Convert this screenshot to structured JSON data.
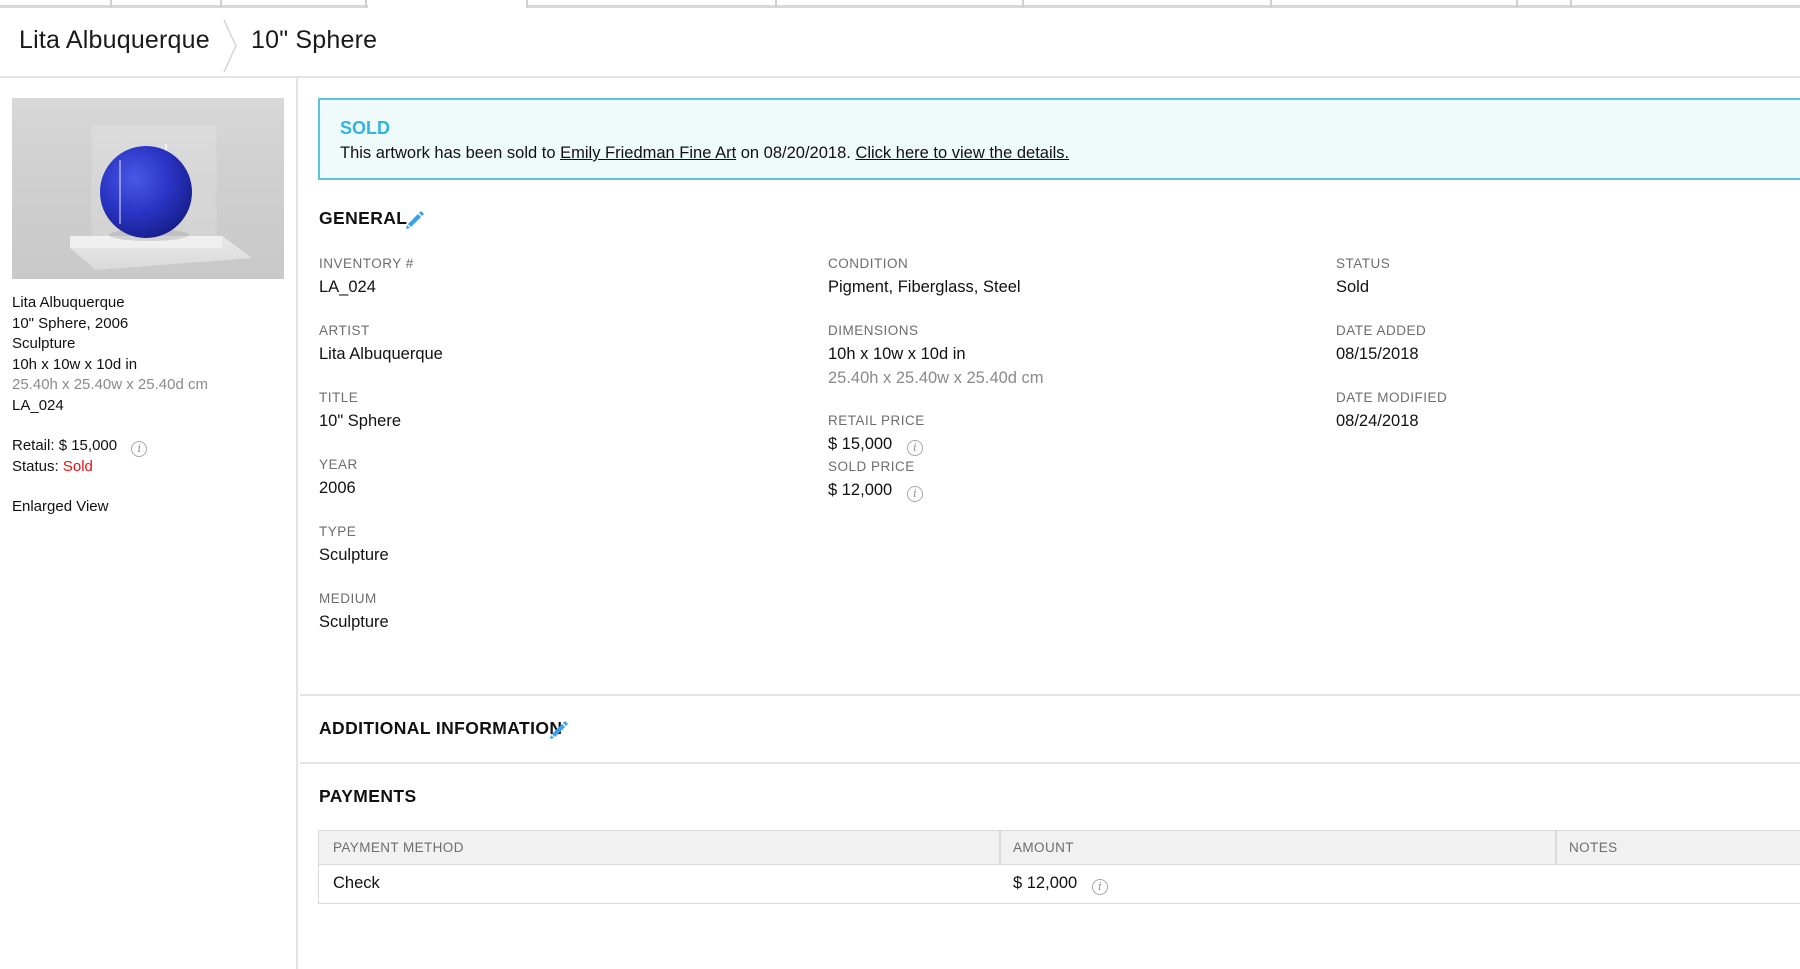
{
  "breadcrumb": {
    "artist": "Lita Albuquerque",
    "artwork": "10\" Sphere"
  },
  "sidebar": {
    "image_alt": "Blue sphere sculpture in acrylic case",
    "lines": [
      "Lita Albuquerque",
      "10\" Sphere, 2006",
      "Sculpture",
      "10h x 10w x 10d in"
    ],
    "metric_dims": "25.40h x 25.40w x 25.40d cm",
    "inventory": "LA_024",
    "retail_label": "Retail:",
    "retail_value": "$ 15,000",
    "status_label": "Status:",
    "status_value": "Sold",
    "enlarged_view": "Enlarged View"
  },
  "banner": {
    "title": "SOLD",
    "text_before": "This artwork has been sold to ",
    "buyer": "Emily Friedman Fine Art",
    "text_middle": " on 08/20/2018. ",
    "details_link": "Click here to view the details."
  },
  "general": {
    "title": "GENERAL",
    "inventory_label": "INVENTORY #",
    "inventory_value": "LA_024",
    "artist_label": "ARTIST",
    "artist_value": "Lita Albuquerque",
    "title_label": "TITLE",
    "title_value": "10\" Sphere",
    "year_label": "YEAR",
    "year_value": "2006",
    "type_label": "TYPE",
    "type_value": "Sculpture",
    "medium_label": "MEDIUM",
    "medium_value": "Sculpture",
    "condition_label": "CONDITION",
    "condition_value": "Pigment, Fiberglass, Steel",
    "dimensions_label": "DIMENSIONS",
    "dimensions_value": "10h x 10w x 10d in",
    "dimensions_metric": "25.40h x 25.40w x 25.40d cm",
    "retail_label": "RETAIL PRICE",
    "retail_value": "$ 15,000",
    "sold_label": "SOLD PRICE",
    "sold_value": "$ 12,000",
    "status_label": "STATUS",
    "status_value": "Sold",
    "added_label": "DATE ADDED",
    "added_value": "08/15/2018",
    "modified_label": "DATE MODIFIED",
    "modified_value": "08/24/2018"
  },
  "additional": {
    "title": "ADDITIONAL INFORMATION"
  },
  "payments": {
    "title": "PAYMENTS",
    "columns": [
      "PAYMENT METHOD",
      "AMOUNT",
      "NOTES"
    ],
    "rows": [
      {
        "method": "Check",
        "amount": "$ 12,000",
        "notes": ""
      }
    ]
  },
  "colors": {
    "accent": "#32b4e0",
    "banner_bg": "#effafb",
    "banner_border": "#5bc4db",
    "sold_red": "#e8110f",
    "sphere_blue": "#2a38c8"
  },
  "icons": {
    "edit": "pencil-icon",
    "info": "info-icon",
    "breadcrumb_separator": "chevron-right-icon"
  }
}
